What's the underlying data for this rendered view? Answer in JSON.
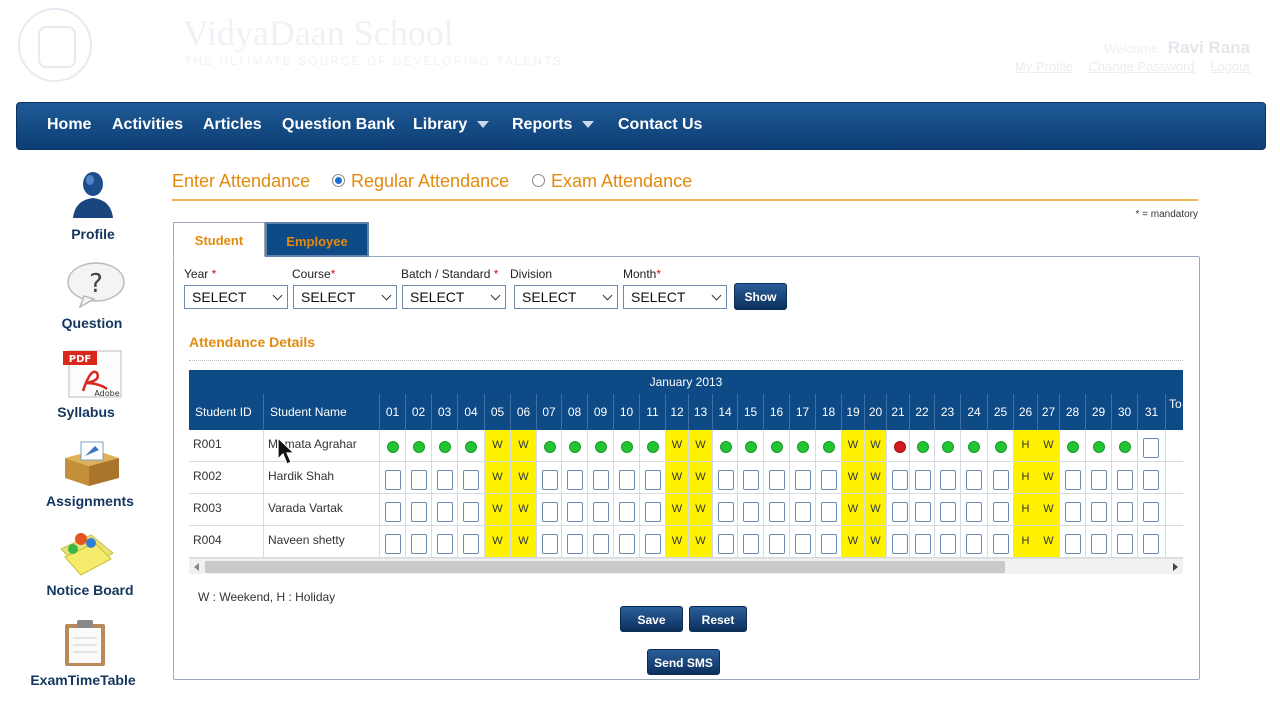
{
  "header": {
    "school_name": "VidyaDaan School",
    "tagline": "THE ULTIMATE SOURCE OF DEVELOPING TALENTS",
    "welcome_text": "Welcome",
    "user_name": "Ravi Rana",
    "links": [
      "My Profile",
      "Change Password",
      "Logout"
    ]
  },
  "nav": {
    "items": [
      {
        "label": "Home"
      },
      {
        "label": "Activities"
      },
      {
        "label": "Articles"
      },
      {
        "label": "Question Bank"
      },
      {
        "label": "Library",
        "dropdown": true
      },
      {
        "label": "Reports",
        "dropdown": true
      },
      {
        "label": "Contact Us"
      }
    ]
  },
  "sidebar": {
    "items": [
      {
        "label": "Profile",
        "icon": "profile-icon"
      },
      {
        "label": "Question",
        "icon": "question-icon"
      },
      {
        "label": "Syllabus",
        "icon": "pdf-icon"
      },
      {
        "label": "Assignments",
        "icon": "assignments-icon"
      },
      {
        "label": "Notice Board",
        "icon": "notice-board-icon"
      },
      {
        "label": "ExamTimeTable",
        "icon": "clipboard-icon"
      }
    ]
  },
  "content": {
    "title": "Enter Attendance",
    "radio_regular": "Regular Attendance",
    "radio_exam": "Exam Attendance",
    "selected_mode": "Regular Attendance",
    "mandatory_note": "* = mandatory",
    "tabs": {
      "student": "Student",
      "employee": "Employee"
    },
    "filters": {
      "year": {
        "label": "Year",
        "value": "SELECT"
      },
      "course": {
        "label": "Course",
        "value": "SELECT"
      },
      "batch": {
        "label": "Batch / Standard",
        "value": "SELECT"
      },
      "division": {
        "label": "Division",
        "value": "SELECT"
      },
      "month": {
        "label": "Month",
        "value": "SELECT"
      },
      "required_mark": "*"
    },
    "show_button": "Show",
    "section_title": "Attendance Details",
    "legend": "W : Weekend, H : Holiday",
    "save_button": "Save",
    "reset_button": "Reset",
    "sms_button": "Send SMS"
  },
  "grid": {
    "month_label": "January 2013",
    "col_student_id": "Student ID",
    "col_student_name": "Student Name",
    "col_total_partial": "To Da",
    "days": [
      "01",
      "02",
      "03",
      "04",
      "05",
      "06",
      "07",
      "08",
      "09",
      "10",
      "11",
      "12",
      "13",
      "14",
      "15",
      "16",
      "17",
      "18",
      "19",
      "20",
      "21",
      "22",
      "23",
      "24",
      "25",
      "26",
      "27",
      "28",
      "29",
      "30",
      "31"
    ],
    "rows": [
      {
        "id": "R001",
        "name": "Mamata Agrahar",
        "cells": [
          "P",
          "P",
          "P",
          "P",
          "W",
          "W",
          "P",
          "P",
          "P",
          "P",
          "P",
          "W",
          "W",
          "P",
          "P",
          "P",
          "P",
          "P",
          "W",
          "W",
          "A",
          "P",
          "P",
          "P",
          "P",
          "H",
          "W",
          "P",
          "P",
          "P",
          "E"
        ]
      },
      {
        "id": "R002",
        "name": "Hardik Shah",
        "cells": [
          "E",
          "E",
          "E",
          "E",
          "W",
          "W",
          "E",
          "E",
          "E",
          "E",
          "E",
          "W",
          "W",
          "E",
          "E",
          "E",
          "E",
          "E",
          "W",
          "W",
          "E",
          "E",
          "E",
          "E",
          "E",
          "H",
          "W",
          "E",
          "E",
          "E",
          "E"
        ]
      },
      {
        "id": "R003",
        "name": "Varada Vartak",
        "cells": [
          "E",
          "E",
          "E",
          "E",
          "W",
          "W",
          "E",
          "E",
          "E",
          "E",
          "E",
          "W",
          "W",
          "E",
          "E",
          "E",
          "E",
          "E",
          "W",
          "W",
          "E",
          "E",
          "E",
          "E",
          "E",
          "H",
          "W",
          "E",
          "E",
          "E",
          "E"
        ]
      },
      {
        "id": "R004",
        "name": "Naveen shetty",
        "cells": [
          "E",
          "E",
          "E",
          "E",
          "W",
          "W",
          "E",
          "E",
          "E",
          "E",
          "E",
          "W",
          "W",
          "E",
          "E",
          "E",
          "E",
          "E",
          "W",
          "W",
          "E",
          "E",
          "E",
          "E",
          "E",
          "H",
          "W",
          "E",
          "E",
          "E",
          "E"
        ]
      }
    ],
    "status_colors": {
      "present": "#22c433",
      "absent": "#d21b1b",
      "highlight": "#fff200"
    }
  }
}
